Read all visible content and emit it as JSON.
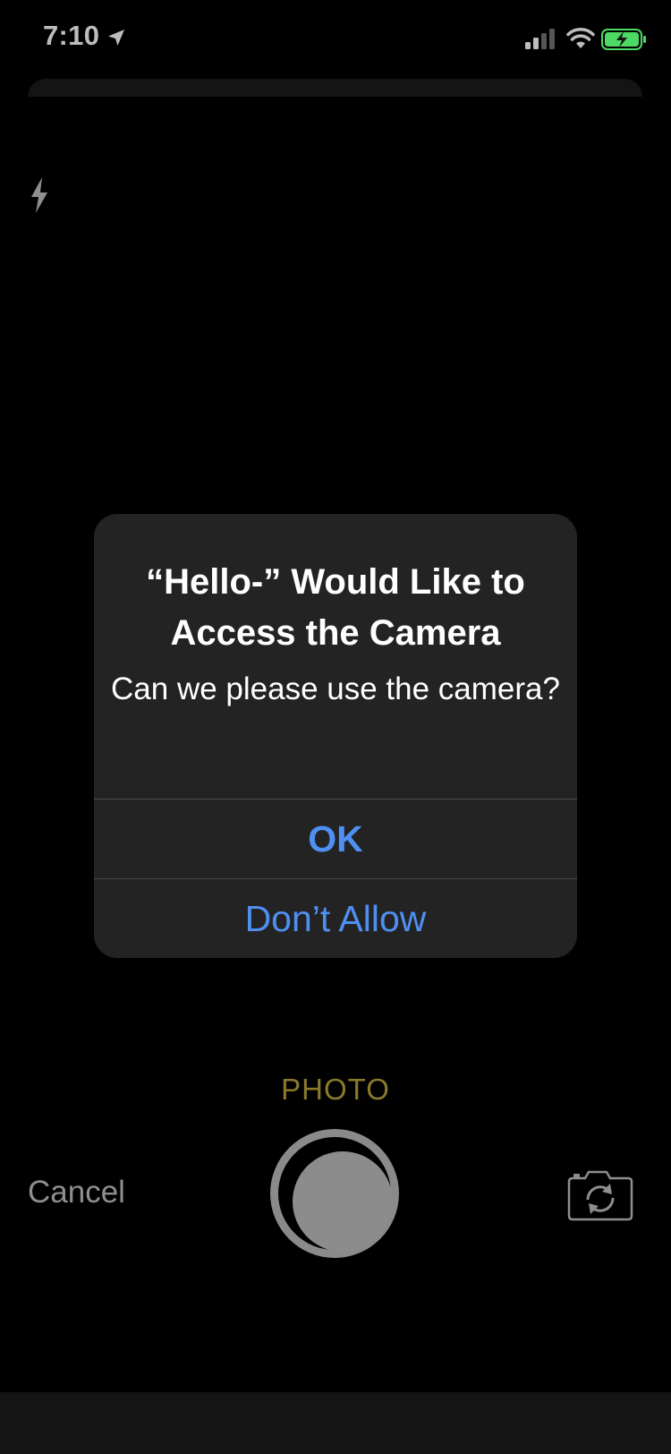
{
  "status_bar": {
    "time": "7:10",
    "location_icon": "location-arrow-icon",
    "signal_icon": "cellular-signal-icon",
    "wifi_icon": "wifi-icon",
    "battery_icon": "battery-charging-icon"
  },
  "camera": {
    "flash_icon": "flash-icon",
    "mode": "PHOTO",
    "cancel_label": "Cancel",
    "shutter_icon": "shutter-button",
    "flip_icon": "flip-camera-icon"
  },
  "alert": {
    "title": "“Hello-” Would Like to Access the Camera",
    "message": "Can we please use the camera?",
    "ok_label": "OK",
    "deny_label": "Don’t Allow"
  },
  "colors": {
    "background": "#000000",
    "alert_background": "#232323",
    "accent_blue": "#4f8ff2",
    "mode_yellow": "#8a7a2a",
    "battery_green": "#4cd964"
  }
}
